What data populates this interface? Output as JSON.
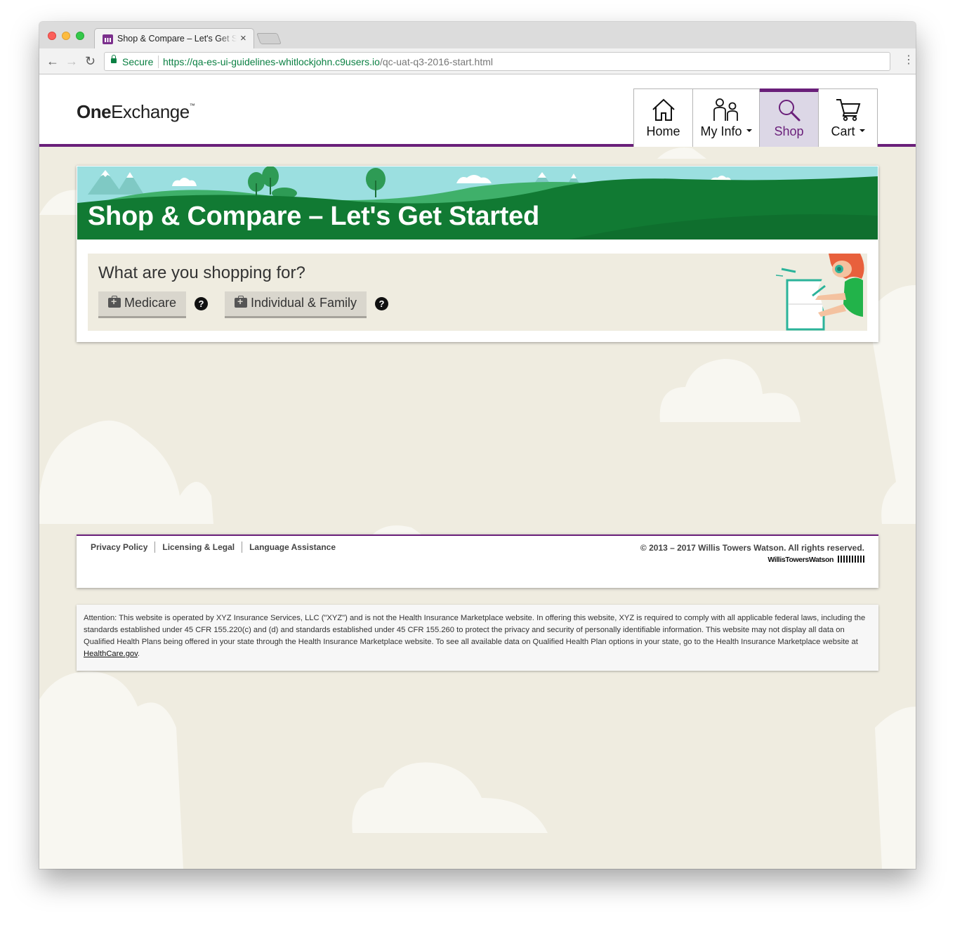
{
  "browser": {
    "tab_title": "Shop & Compare – Let's Get Started",
    "tab_close": "×",
    "secure_label": "Secure",
    "url_host": "https://qa-es-ui-guidelines-whitlockjohn.c9users.io",
    "url_path": "/qc-uat-q3-2016-start.html",
    "back": "←",
    "forward": "→",
    "reload": "↻",
    "menu": "⋮"
  },
  "header": {
    "logo_bold": "One",
    "logo_rest": "Exchange",
    "logo_tm": "™",
    "nav": [
      {
        "label": "Home",
        "icon": "home-icon",
        "dropdown": false
      },
      {
        "label": "My Info",
        "icon": "people-icon",
        "dropdown": true
      },
      {
        "label": "Shop",
        "icon": "search-icon",
        "dropdown": false,
        "active": true
      },
      {
        "label": "Cart",
        "icon": "cart-icon",
        "dropdown": true
      }
    ]
  },
  "banner": {
    "title": "Shop & Compare – Let's Get Started"
  },
  "shopping": {
    "question": "What are you shopping for?",
    "options": [
      {
        "label": "Medicare",
        "help": "?"
      },
      {
        "label": "Individual & Family",
        "help": "?"
      }
    ]
  },
  "footer": {
    "links": [
      "Privacy Policy",
      "Licensing & Legal",
      "Language Assistance"
    ],
    "copyright": "© 2013 – 2017 Willis Towers Watson. All rights reserved.",
    "brand": "WillisTowersWatson"
  },
  "disclaimer": {
    "text": "Attention: This website is operated by XYZ Insurance Services, LLC (\"XYZ\") and is not the Health Insurance Marketplace website. In offering this website, XYZ is required to comply with all applicable federal laws, including the standards established under 45 CFR 155.220(c) and (d) and standards established under 45 CFR 155.260 to protect the privacy and security of personally identifiable information. This website may not display all data on Qualified Health Plans being offered in your state through the Health Insurance Marketplace website. To see all available data on Qualified Health Plan options in your state, go to the Health Insurance Marketplace website at ",
    "link": "HealthCare.gov",
    "end": "."
  },
  "colors": {
    "brand_purple": "#6a1f7a",
    "banner_green": "#117a33",
    "sky": "#9bdfe0",
    "page_bg": "#efece0"
  }
}
